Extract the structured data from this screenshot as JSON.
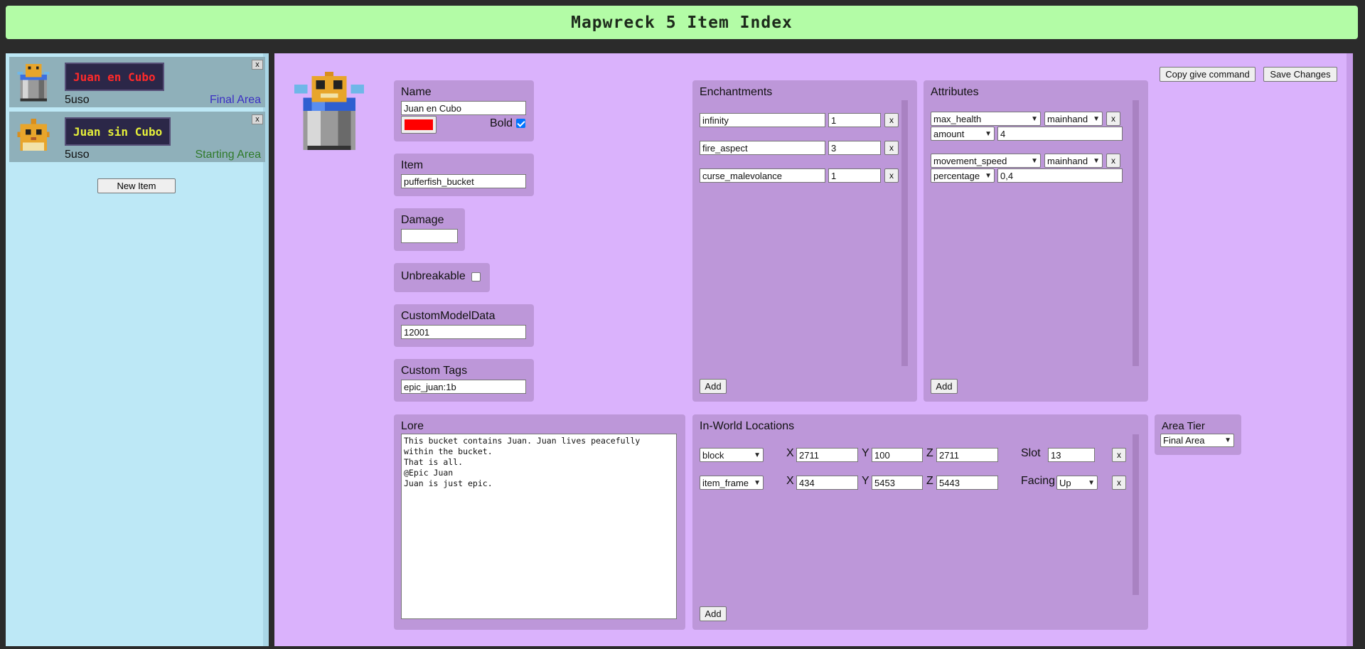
{
  "app": {
    "title": "Mapwreck 5 Item Index"
  },
  "sidebar": {
    "items": [
      {
        "name": "Juan en Cubo",
        "name_color": "#ff2a2a",
        "uses": "5uso",
        "area": "Final Area",
        "area_color": "#3b2fc4",
        "close": "x"
      },
      {
        "name": "Juan sin Cubo",
        "name_color": "#e6f03a",
        "uses": "5uso",
        "area": "Starting Area",
        "area_color": "#2f7a2a",
        "close": "x"
      }
    ],
    "new_item_label": "New Item"
  },
  "toolbar": {
    "copy_label": "Copy give command",
    "save_label": "Save Changes"
  },
  "name_panel": {
    "title": "Name",
    "value": "Juan en Cubo",
    "color": "#ff0000",
    "bold_label": "Bold",
    "bold": true
  },
  "item_panel": {
    "title": "Item",
    "value": "pufferfish_bucket"
  },
  "damage_panel": {
    "title": "Damage",
    "value": ""
  },
  "unbreakable_panel": {
    "title": "Unbreakable",
    "checked": false
  },
  "cmd_panel": {
    "title": "CustomModelData",
    "value": "12001"
  },
  "tags_panel": {
    "title": "Custom Tags",
    "value": "epic_juan:1b"
  },
  "enchantments": {
    "title": "Enchantments",
    "rows": [
      {
        "name": "infinity",
        "level": "1",
        "remove": "x"
      },
      {
        "name": "fire_aspect",
        "level": "3",
        "remove": "x"
      },
      {
        "name": "curse_malevolance",
        "level": "1",
        "remove": "x"
      }
    ],
    "add_label": "Add"
  },
  "attributes": {
    "title": "Attributes",
    "rows": [
      {
        "attribute": "max_health",
        "slot": "mainhand",
        "operation": "amount",
        "value": "4",
        "remove": "x"
      },
      {
        "attribute": "movement_speed",
        "slot": "mainhand",
        "operation": "percentage",
        "value": "0,4",
        "remove": "x"
      }
    ],
    "add_label": "Add"
  },
  "lore": {
    "title": "Lore",
    "text": "This bucket contains Juan. Juan lives peacefully\nwithin the bucket.\nThat is all.\n@Epic Juan\nJuan is just epic."
  },
  "locations": {
    "title": "In-World Locations",
    "rows": [
      {
        "type": "block",
        "x_label": "X",
        "x": "2711",
        "y_label": "Y",
        "y": "100",
        "z_label": "Z",
        "z": "2711",
        "extra_label": "Slot",
        "extra_value": "13",
        "remove": "x"
      },
      {
        "type": "item_frame",
        "x_label": "X",
        "x": "434",
        "y_label": "Y",
        "y": "5453",
        "z_label": "Z",
        "z": "5443",
        "extra_label": "Facing",
        "extra_value": "Up",
        "remove": "x"
      }
    ],
    "add_label": "Add"
  },
  "area_tier": {
    "title": "Area Tier",
    "value": "Final Area"
  },
  "icons": {
    "item_preview": "pufferfish-bucket-icon",
    "dropdown": "chevron-down-icon"
  }
}
